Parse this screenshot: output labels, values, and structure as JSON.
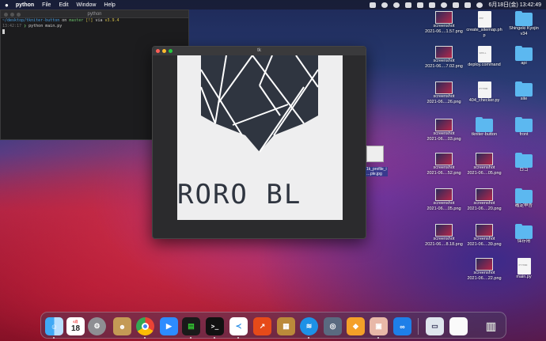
{
  "menubar": {
    "app": "python",
    "items": [
      "File",
      "Edit",
      "Window",
      "Help"
    ],
    "clock": "6月18日(金) 13:42:49"
  },
  "terminal": {
    "title": "python",
    "prompt_path": "~/desktop/tkniter-button",
    "prompt_on": "on",
    "branch": "master",
    "status": "[!]",
    "via": "via",
    "version": "v3.9.4",
    "time": "13:42:17",
    "command": "python main.py"
  },
  "tk_window": {
    "title": "tk",
    "logo_text": "RORO BL"
  },
  "drag_label": "1k_profile_i\n…ple.jpg",
  "desktop": {
    "col1": [
      "screenshot\n2021-06....1.57.png",
      "screenshot\n2021-06....7.02.png",
      "screenshot\n2021-06....26.png",
      "screenshot\n2021-06....03.png",
      "screenshot\n2021-06....52.png",
      "screenshot\n2021-06....05.png",
      "screenshot\n2021-06....8.18.png"
    ],
    "col2": [
      "create_sitemap.ph\np",
      "deploy.command",
      "404_checker.py",
      "tkniter-button",
      "screenshot\n2021-06....05.png",
      "screenshot\n2021-06....20.png",
      "screenshot\n2021-06....39.png",
      "screenshot\n2021-06....22.png"
    ],
    "col3": [
      "Shingeki Kyojin\nv34",
      "api",
      "site",
      "front",
      "ロゴ",
      "確定申告",
      "保存用",
      "main.py"
    ],
    "doc_tags": [
      "PHP",
      "SHELL",
      "PYTHON"
    ],
    "main_tag": "PYTHON"
  },
  "dock": {
    "calendar_month": "6月",
    "calendar_day": "18",
    "apps": [
      "finder-icon",
      "calendar-icon",
      "system-preferences-icon",
      "contacts-icon",
      "chrome-icon",
      "zoom-icon",
      "activity-monitor-icon",
      "terminal-icon",
      "vscode-icon",
      "sourcetree-icon",
      "docker-icon",
      "proxyman-icon",
      "sourcetree-git-icon",
      "preview-icon",
      "infinity-icon",
      "downloads-icon",
      "document-icon",
      "trash-icon"
    ]
  },
  "colors": {
    "logo_dark": "#2f3540",
    "logo_bg": "#eeeeef",
    "folder_blue": "#5cb8f0"
  }
}
